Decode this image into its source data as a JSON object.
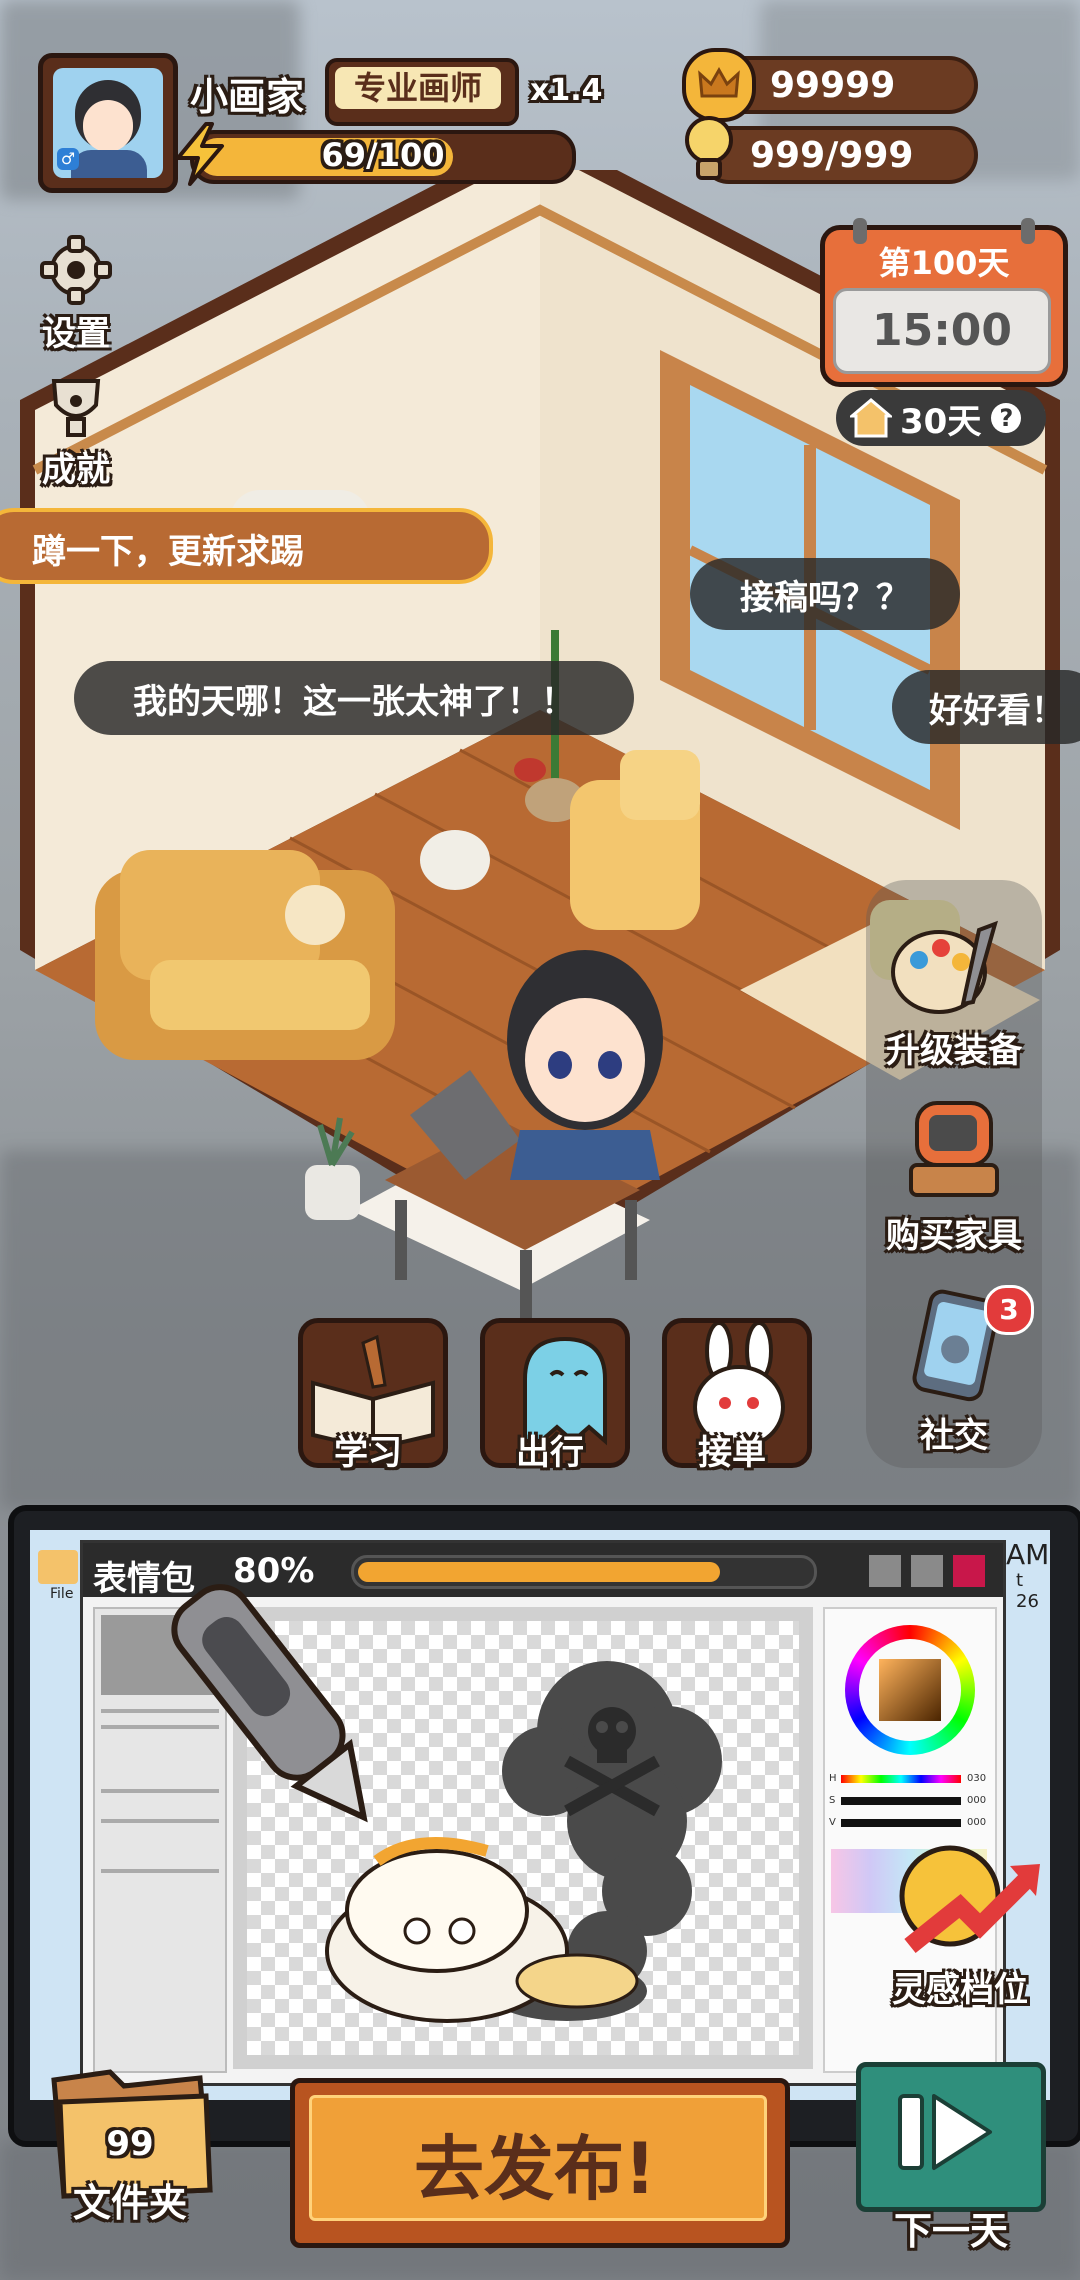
{
  "player": {
    "name": "小画家",
    "title": "专业画师",
    "multiplier": "x1.4",
    "energy_text": "69/100",
    "energy_value": 69,
    "energy_max": 100
  },
  "resources": {
    "coins": "99999",
    "inspiration": "999/999"
  },
  "calendar": {
    "day_label": "第100天",
    "time": "15:00",
    "rent_days": "30天",
    "help": "?"
  },
  "side_menu": {
    "settings": "设置",
    "achievements": "成就"
  },
  "banner": {
    "text": "蹲一下，更新求踢"
  },
  "comments": [
    "接稿吗？？",
    "我的天哪！这一张太神了！！",
    "好好看！"
  ],
  "right_menu": {
    "upgrade": "升级装备",
    "furniture": "购买家具",
    "social": "社交",
    "social_badge": "3"
  },
  "actions": {
    "study": "学习",
    "travel": "出行",
    "commission": "接单"
  },
  "drawing": {
    "label": "表情包",
    "progress_text": "80%",
    "progress_value": 0.8,
    "desktop_file_label": "File",
    "clock_partial": "AM",
    "date_partial": "t 26"
  },
  "color_panel": {
    "h_label": "H",
    "s_label": "S",
    "v_label": "V",
    "h_value": "030",
    "s_value": "000",
    "v_value": "000"
  },
  "inspiration_tier": "灵感档位",
  "folder": {
    "count": "99",
    "label": "文件夹"
  },
  "publish_button": "去发布!",
  "next_day_button": "下一天",
  "colors": {
    "wood_dark": "#5a2e1b",
    "orange_button": "#f0a038",
    "teal_button": "#2f8f7c",
    "energy_bar": "#f4b63a",
    "progress_bar": "#f2a531"
  }
}
